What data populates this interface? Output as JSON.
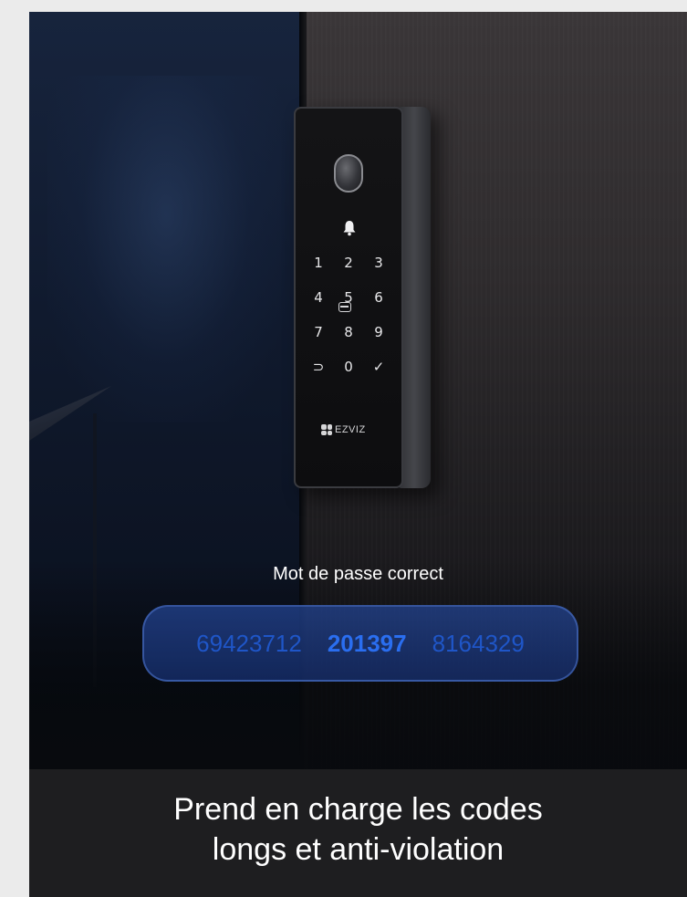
{
  "keypad": {
    "rows": [
      [
        "1",
        "2",
        "3"
      ],
      [
        "4",
        "5",
        "6"
      ],
      [
        "7",
        "8",
        "9"
      ],
      [
        "⊃",
        "0",
        "✓"
      ]
    ],
    "brand": "EZVIZ",
    "icons": [
      "fingerprint-sensor-icon",
      "bell-icon",
      "card-icon"
    ]
  },
  "status": {
    "label": "Mot de passe correct"
  },
  "codes": {
    "prefix": "69423712",
    "active": "201397",
    "suffix": "8164329"
  },
  "caption": {
    "line1": "Prend en charge les codes",
    "line2": "longs et anti-violation"
  },
  "colors": {
    "accent": "#2a6ef0",
    "pill_bg": "#24468f",
    "caption_bg": "#1e1e20"
  }
}
